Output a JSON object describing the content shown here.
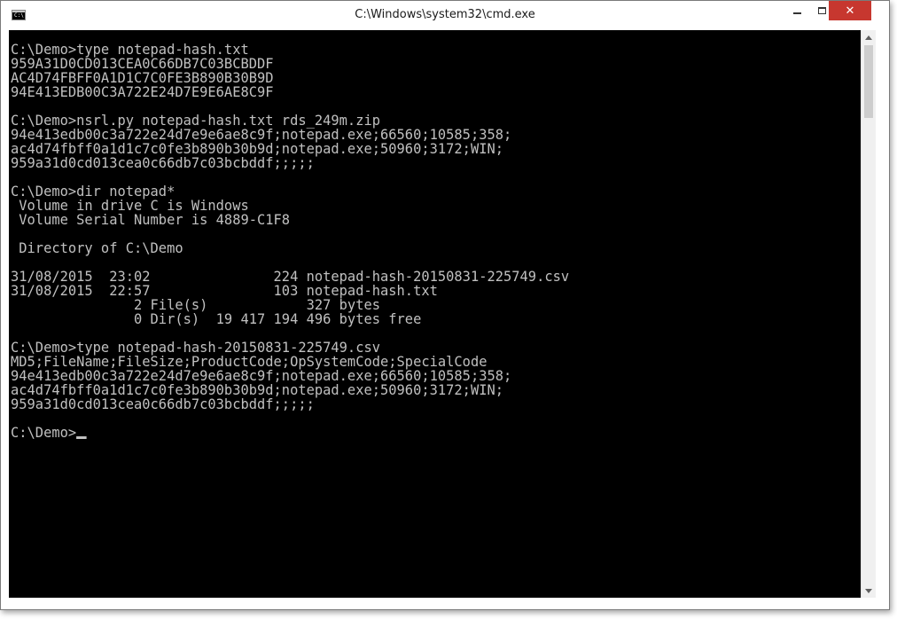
{
  "window": {
    "title": "C:\\Windows\\system32\\cmd.exe",
    "icon_label": "C:\\",
    "icons": {
      "app": "console-icon",
      "minimize": "minimize-icon",
      "maximize": "maximize-icon",
      "close": "close-icon",
      "scroll_up": "chevron-up-icon",
      "scroll_down": "chevron-down-icon"
    },
    "close_glyph": "✕",
    "colors": {
      "console_background": "#000000",
      "console_text": "#c0c0c0",
      "close_button": "#c7372f"
    }
  },
  "console": {
    "lines": [
      "C:\\Demo>type notepad-hash.txt",
      "959A31D0CD013CEA0C66DB7C03BCBDDF",
      "AC4D74FBFF0A1D1C7C0FE3B890B30B9D",
      "94E413EDB00C3A722E24D7E9E6AE8C9F",
      "",
      "C:\\Demo>nsrl.py notepad-hash.txt rds_249m.zip",
      "94e413edb00c3a722e24d7e9e6ae8c9f;notepad.exe;66560;10585;358;",
      "ac4d74fbff0a1d1c7c0fe3b890b30b9d;notepad.exe;50960;3172;WIN;",
      "959a31d0cd013cea0c66db7c03bcbddf;;;;;",
      "",
      "C:\\Demo>dir notepad*",
      " Volume in drive C is Windows",
      " Volume Serial Number is 4889-C1F8",
      "",
      " Directory of C:\\Demo",
      "",
      "31/08/2015  23:02               224 notepad-hash-20150831-225749.csv",
      "31/08/2015  22:57               103 notepad-hash.txt",
      "               2 File(s)            327 bytes",
      "               0 Dir(s)  19 417 194 496 bytes free",
      "",
      "C:\\Demo>type notepad-hash-20150831-225749.csv",
      "MD5;FileName;FileSize;ProductCode;OpSystemCode;SpecialCode",
      "94e413edb00c3a722e24d7e9e6ae8c9f;notepad.exe;66560;10585;358;",
      "ac4d74fbff0a1d1c7c0fe3b890b30b9d;notepad.exe;50960;3172;WIN;",
      "959a31d0cd013cea0c66db7c03bcbddf;;;;;",
      ""
    ],
    "prompt": "C:\\Demo>"
  }
}
